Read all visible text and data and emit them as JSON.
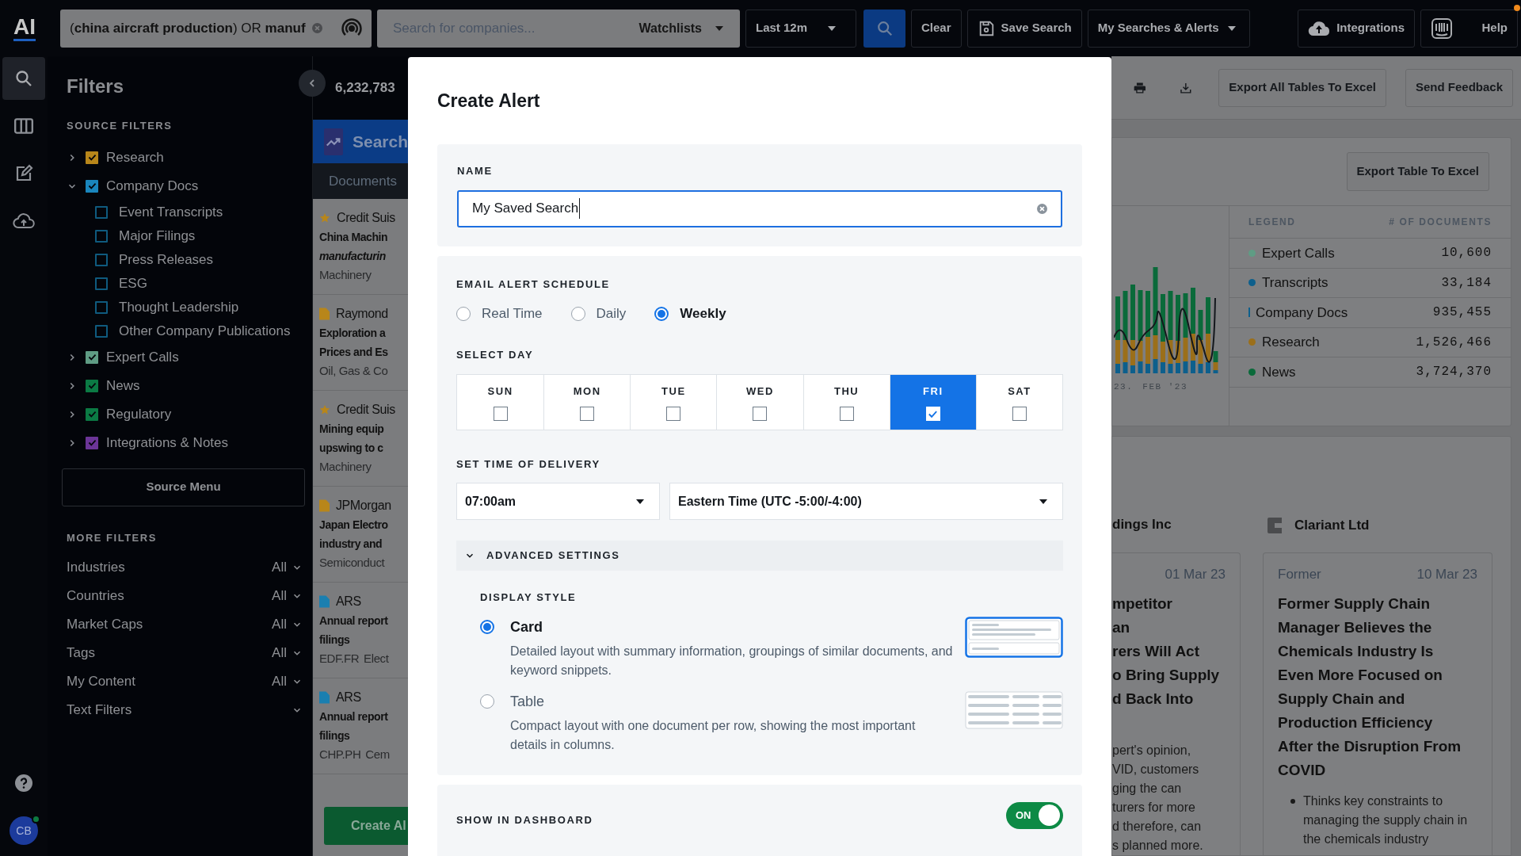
{
  "top_bar": {
    "logo": "AI",
    "query": "(**china** **aircraft** **production**) OR **manuf**",
    "company_search": {
      "placeholder": "Search for companies...",
      "watchlists": "Watchlists"
    },
    "period": "Last 12m",
    "clear": "Clear",
    "save_search": "Save Search",
    "my_searches": "My Searches & Alerts",
    "integrations": "Integrations",
    "help": "Help"
  },
  "nav_items": [
    {
      "selected": true
    },
    {
      "selected": false
    },
    {
      "selected": false
    },
    {
      "selected": false
    }
  ],
  "avatar": "CB",
  "filters": {
    "title": "Filters",
    "source_heading": "SOURCE FILTERS",
    "sources": [
      {
        "label": "Research",
        "checked": true,
        "expanded": false,
        "color": "#b8861a"
      },
      {
        "label": "Company Docs",
        "checked": true,
        "expanded": true,
        "color": "#1a86bd",
        "children": [
          {
            "label": "Event Transcripts",
            "checked": false
          },
          {
            "label": "Major Filings",
            "checked": false
          },
          {
            "label": "Press Releases",
            "checked": false
          },
          {
            "label": "ESG",
            "checked": false
          },
          {
            "label": "Thought Leadership",
            "checked": false
          },
          {
            "label": "Other Company Publications",
            "checked": false
          }
        ]
      },
      {
        "label": "Expert Calls",
        "checked": true,
        "expanded": false,
        "color": "#5f9c84"
      },
      {
        "label": "News",
        "checked": true,
        "expanded": false,
        "color": "#0b7a44"
      },
      {
        "label": "Regulatory",
        "checked": true,
        "expanded": false,
        "color": "#0b7a44"
      },
      {
        "label": "Integrations & Notes",
        "checked": true,
        "expanded": false,
        "color": "#6b3597"
      }
    ],
    "source_menu": "Source Menu",
    "more_heading": "MORE FILTERS",
    "more": [
      {
        "label": "Industries",
        "value": "All"
      },
      {
        "label": "Countries",
        "value": "All"
      },
      {
        "label": "Market Caps",
        "value": "All"
      },
      {
        "label": "Tags",
        "value": "All"
      },
      {
        "label": "My Content",
        "value": "All"
      },
      {
        "label": "Text Filters"
      }
    ]
  },
  "results": {
    "count": "6,232,783",
    "banner": "Search",
    "tab": "Documents",
    "items": [
      {
        "kind": "star",
        "color": "#b8861a",
        "source": "Credit Suis",
        "title": [
          "China Machin",
          "*manufacturin*"
        ],
        "meta": [
          "Machinery"
        ]
      },
      {
        "kind": "doc",
        "color": "#b8861a",
        "source": "Raymond",
        "title": [
          "Exploration a",
          "Prices and Es"
        ],
        "meta": [
          "Oil, Gas & Co"
        ]
      },
      {
        "kind": "star",
        "color": "#b8861a",
        "source": "Credit Suis",
        "title": [
          "Mining equip",
          "upswing to c"
        ],
        "meta": [
          "Machinery"
        ]
      },
      {
        "kind": "doc",
        "color": "#b8861a",
        "source": "JPMorgan",
        "title": [
          "Japan Electro",
          "industry and"
        ],
        "meta": [
          "Semiconduct"
        ]
      },
      {
        "kind": "doc",
        "color": "#1a7fb0",
        "source": "ARS",
        "title": [
          "Annual report",
          "filings"
        ],
        "meta": [
          "EDF.FR",
          "Elect"
        ]
      },
      {
        "kind": "doc",
        "color": "#1a7fb0",
        "source": "ARS",
        "title": [
          "Annual report",
          "filings"
        ],
        "meta": [
          "CHP.PH",
          "Cem"
        ]
      }
    ],
    "create_button": "Create Al"
  },
  "modal": {
    "title": "Create Alert",
    "name_label": "NAME",
    "name_value": "My Saved Search",
    "schedule_label": "EMAIL ALERT SCHEDULE",
    "schedules": [
      {
        "label": "Real Time",
        "selected": false
      },
      {
        "label": "Daily",
        "selected": false
      },
      {
        "label": "Weekly",
        "selected": true
      }
    ],
    "day_label": "SELECT DAY",
    "days": [
      {
        "label": "SUN",
        "selected": false
      },
      {
        "label": "MON",
        "selected": false
      },
      {
        "label": "TUE",
        "selected": false
      },
      {
        "label": "WED",
        "selected": false
      },
      {
        "label": "THU",
        "selected": false
      },
      {
        "label": "FRI",
        "selected": true
      },
      {
        "label": "SAT",
        "selected": false
      }
    ],
    "time_label": "SET TIME OF DELIVERY",
    "time": "07:00am",
    "timezone": "Eastern Time (UTC -5:00/-4:00)",
    "advanced": {
      "label": "ADVANCED SETTINGS",
      "expanded": true
    },
    "display_label": "DISPLAY STYLE",
    "styles": [
      {
        "kind": "card",
        "label": "Card",
        "description": "Detailed layout with summary information, groupings of similar documents, and keyword snippets.",
        "selected": true
      },
      {
        "kind": "table",
        "label": "Table",
        "description": "Compact layout with one document per row, showing the most important details in columns.",
        "selected": false
      }
    ],
    "dashboard_label": "SHOW IN DASHBOARD",
    "dashboard": {
      "on": true,
      "text": "ON"
    }
  },
  "toolbar": {
    "export_all": "Export All Tables To Excel",
    "feedback": "Send Feedback"
  },
  "chart_card": {
    "export": "Export Table To Excel",
    "axis_labels": [
      "23.",
      "FEB '23"
    ],
    "legend_heading": "LEGEND",
    "count_heading": "# OF DOCUMENTS",
    "legend": [
      {
        "kind": "dot",
        "label": "Expert Calls",
        "count": "10,600",
        "color": "#5f9c84"
      },
      {
        "kind": "dot",
        "label": "Transcripts",
        "count": "33,184",
        "color": "#0d5f8c"
      },
      {
        "kind": "line",
        "label": "Company Docs",
        "count": "935,455",
        "color": "#0d5f8c"
      },
      {
        "kind": "dot",
        "label": "Research",
        "count": "1,526,466",
        "color": "#9b6f1a"
      },
      {
        "kind": "dot",
        "label": "News",
        "count": "3,724,370",
        "color": "#0a6a3a"
      }
    ]
  },
  "companies": [
    {
      "name": "dings Inc",
      "date": "01 Mar 23",
      "title": [
        "mpetitor",
        "an",
        "rers Will Act",
        "o Bring Supply",
        "d Back Into"
      ],
      "body": [
        "pert's opinion,",
        "VID, customers",
        "ging the can",
        "turers for more",
        "d therefore, can",
        "s planned more."
      ]
    },
    {
      "name": "Clariant Ltd",
      "role": "Former",
      "date": "10 Mar 23",
      "title": [
        "Former Supply Chain",
        "Manager Believes the",
        "Chemicals Industry Is",
        "Even More Focused on",
        "Supply Chain and",
        "Production Efficiency",
        "After the Disruption From",
        "COVID"
      ],
      "bullet": "Thinks key constraints to managing the supply chain in the chemicals industry"
    }
  ]
}
